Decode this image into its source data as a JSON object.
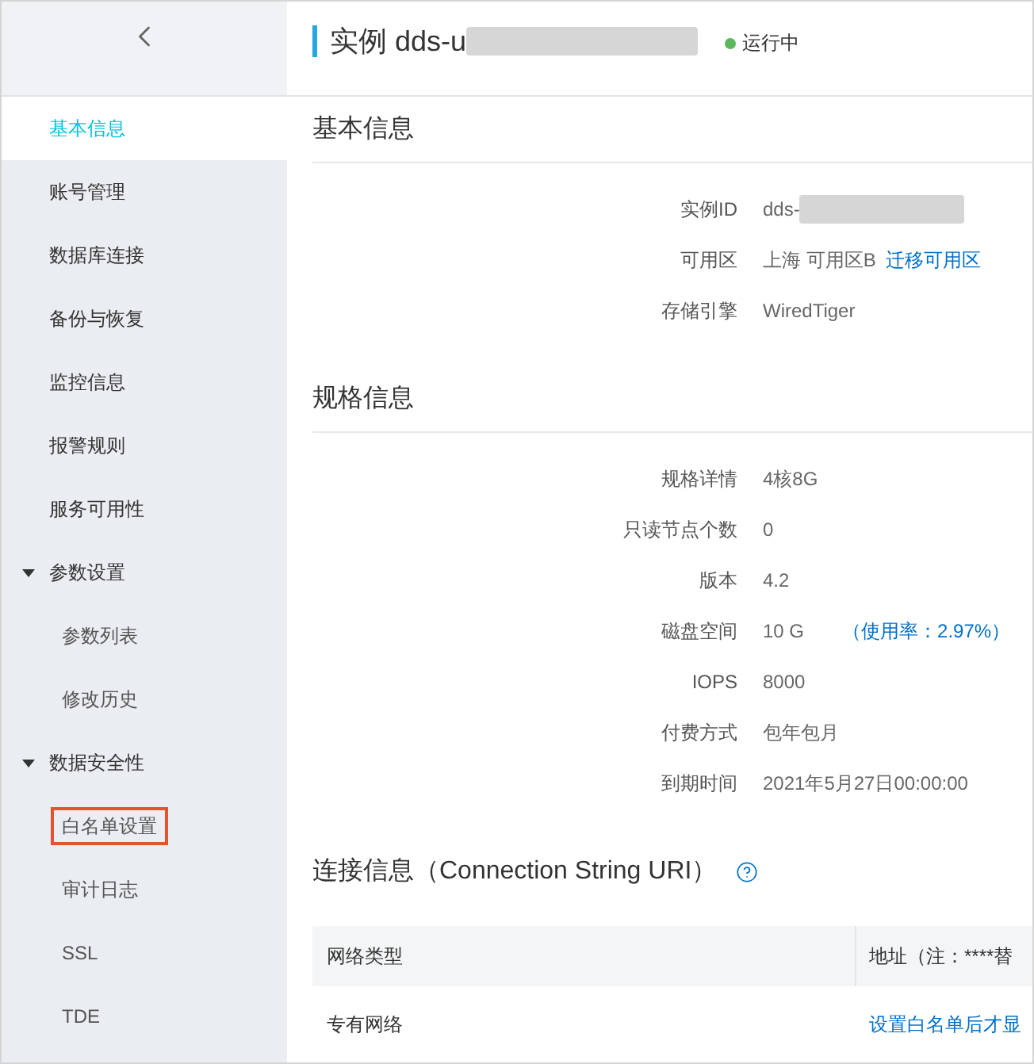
{
  "sidebar": {
    "items": [
      {
        "label": "基本信息",
        "selected": true,
        "highlighted": false
      },
      {
        "label": "账号管理",
        "selected": false,
        "highlighted": false
      },
      {
        "label": "数据库连接",
        "selected": false,
        "highlighted": false
      },
      {
        "label": "备份与恢复",
        "selected": false,
        "highlighted": false
      },
      {
        "label": "监控信息",
        "selected": false,
        "highlighted": false
      },
      {
        "label": "报警规则",
        "selected": false,
        "highlighted": false
      },
      {
        "label": "服务可用性",
        "selected": false,
        "highlighted": false
      },
      {
        "label": "参数设置",
        "selected": false,
        "highlighted": false,
        "expanded": true,
        "children": [
          {
            "label": "参数列表",
            "selected": false,
            "highlighted": false
          },
          {
            "label": "修改历史",
            "selected": false,
            "highlighted": false
          }
        ]
      },
      {
        "label": "数据安全性",
        "selected": false,
        "highlighted": false,
        "expanded": true,
        "children": [
          {
            "label": "白名单设置",
            "selected": false,
            "highlighted": true
          },
          {
            "label": "审计日志",
            "selected": false,
            "highlighted": false
          },
          {
            "label": "SSL",
            "selected": false,
            "highlighted": false
          },
          {
            "label": "TDE",
            "selected": false,
            "highlighted": false
          }
        ]
      }
    ]
  },
  "header": {
    "title": "实例 dds-u",
    "redacted": true,
    "status": "运行中"
  },
  "sections": [
    {
      "title": "基本信息",
      "fields": [
        {
          "label": "实例ID",
          "value": "dds-",
          "redacted": true
        },
        {
          "label": "可用区",
          "value": "上海 可用区B",
          "link": "迁移可用区",
          "redacted": false
        },
        {
          "label": "存储引擎",
          "value": "WiredTiger",
          "redacted": false
        }
      ]
    },
    {
      "title": "规格信息",
      "fields": [
        {
          "label": "规格详情",
          "value": "4核8G",
          "redacted": false
        },
        {
          "label": "只读节点个数",
          "value": "0",
          "redacted": false
        },
        {
          "label": "版本",
          "value": "4.2",
          "redacted": false
        },
        {
          "label": "磁盘空间",
          "value": "10 G",
          "note": "（使用率：2.97%）",
          "redacted": false
        },
        {
          "label": "IOPS",
          "value": "8000",
          "redacted": false
        },
        {
          "label": "付费方式",
          "value": "包年包月",
          "redacted": false
        },
        {
          "label": "到期时间",
          "value": "2021年5月27日00:00:00",
          "redacted": false
        }
      ]
    }
  ],
  "connection": {
    "title": "连接信息（Connection String URI）",
    "table": {
      "columns": [
        "网络类型",
        "地址（注：****替"
      ],
      "rows": [
        {
          "network_type": "专有网络",
          "address_link": "设置白名单后才显"
        }
      ]
    }
  }
}
